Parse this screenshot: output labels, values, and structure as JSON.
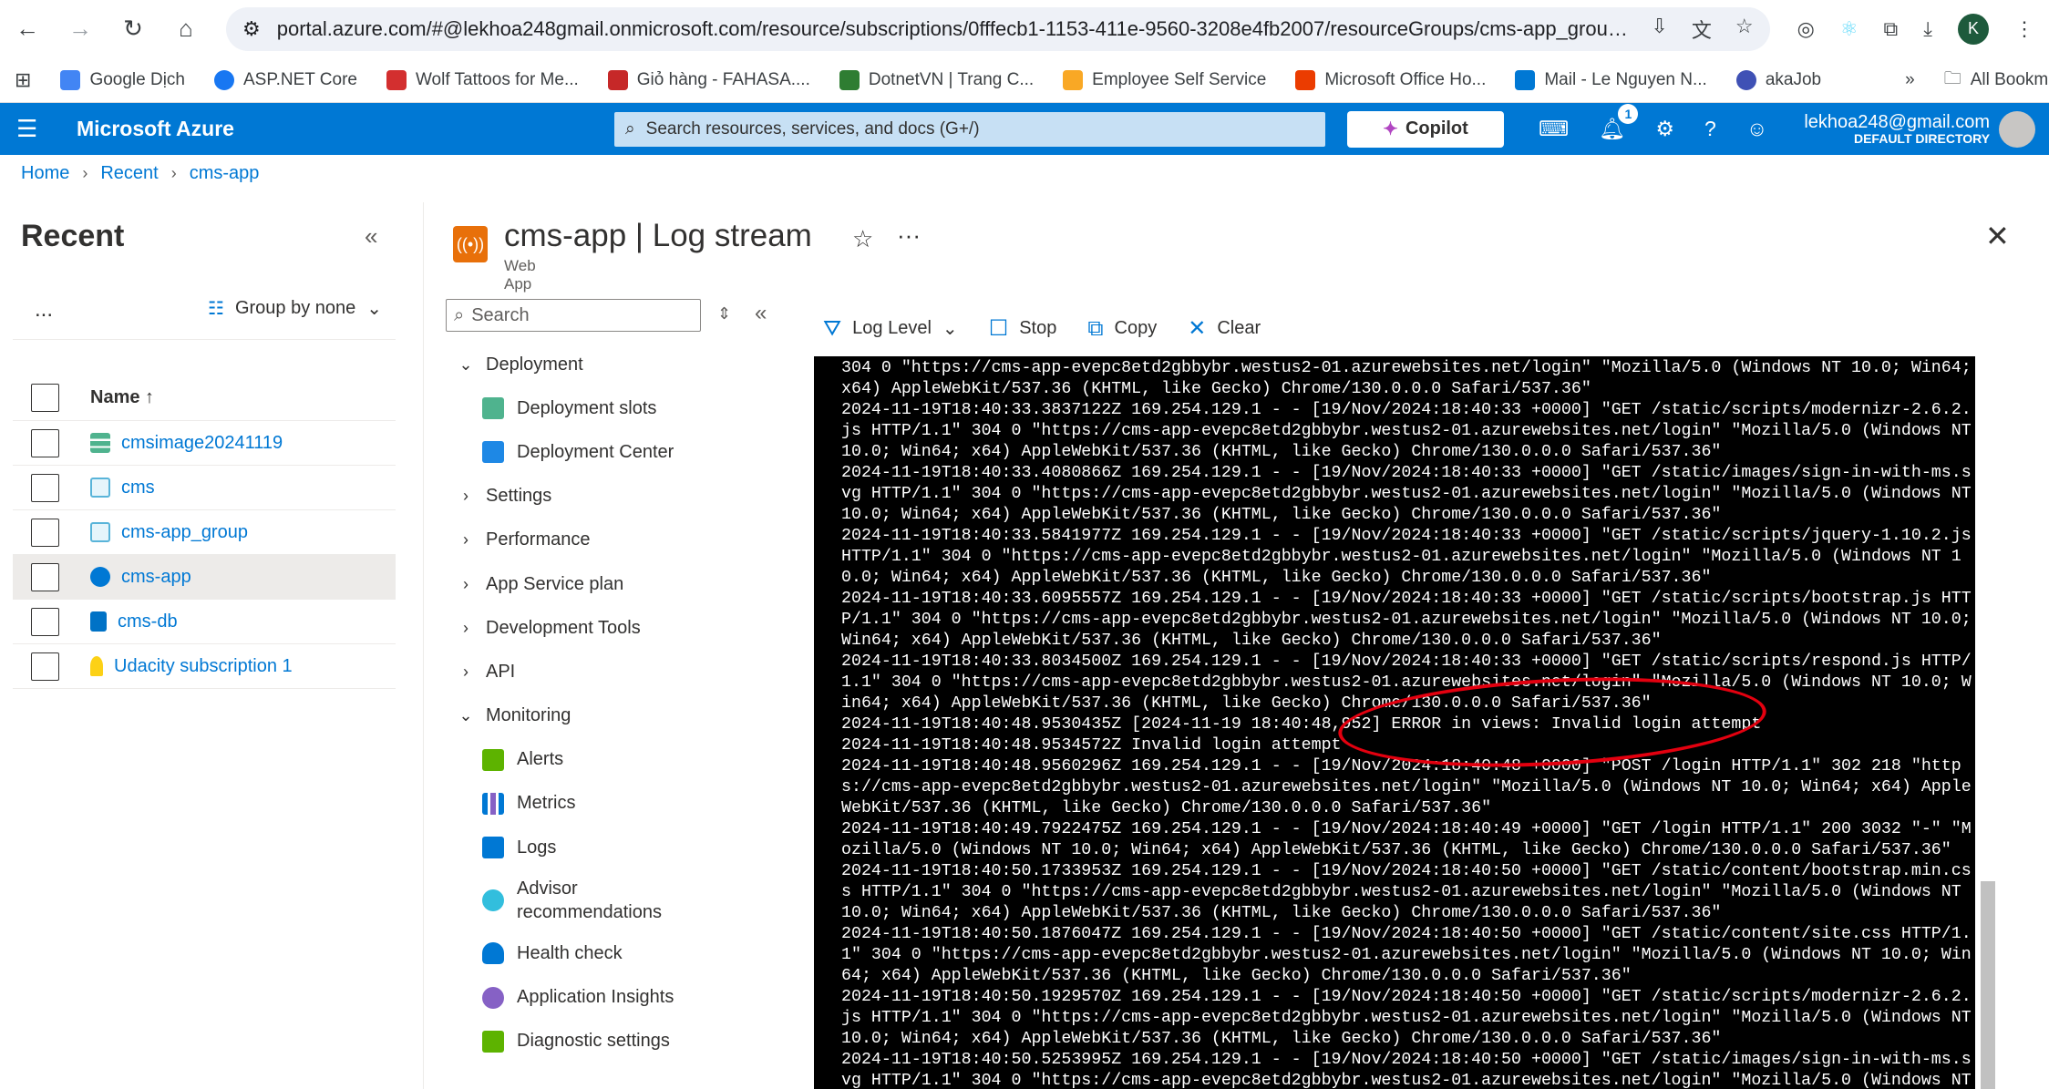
{
  "browser": {
    "url": "portal.azure.com/#@lekhoa248gmail.onmicrosoft.com/resource/subscriptions/0fffecb1-1153-411e-9560-3208e4fb2007/resourceGroups/cms-app_group...",
    "avatar_letter": "K",
    "bookmarks": [
      "Google Dịch",
      "ASP.NET Core",
      "Wolf Tattoos for Me...",
      "Giỏ hàng - FAHASA....",
      "DotnetVN | Trang C...",
      "Employee Self Service",
      "Microsoft Office Ho...",
      "Mail - Le Nguyen N...",
      "akaJob"
    ],
    "all_bookmarks": "All Bookmarks",
    "more": "»"
  },
  "azure": {
    "brand": "Microsoft Azure",
    "search_placeholder": "Search resources, services, and docs (G+/)",
    "copilot": "Copilot",
    "notif_count": "1",
    "account_email": "lekhoa248@gmail.com",
    "account_dir": "DEFAULT DIRECTORY"
  },
  "breadcrumb": [
    "Home",
    "Recent",
    "cms-app"
  ],
  "recent": {
    "title": "Recent",
    "more": "...",
    "group_by": "Group by none",
    "header": "Name ↑",
    "items": [
      "cmsimage20241119",
      "cms",
      "cms-app_group",
      "cms-app",
      "cms-db",
      "Udacity subscription 1"
    ]
  },
  "blade": {
    "title": "cms-app | Log stream",
    "subtitle": "Web App"
  },
  "menu": {
    "search_placeholder": "Search",
    "items": [
      {
        "label": "Deployment",
        "type": "expanded"
      },
      {
        "label": "Deployment slots",
        "type": "child"
      },
      {
        "label": "Deployment Center",
        "type": "child"
      },
      {
        "label": "Settings",
        "type": "collapsed"
      },
      {
        "label": "Performance",
        "type": "collapsed"
      },
      {
        "label": "App Service plan",
        "type": "collapsed"
      },
      {
        "label": "Development Tools",
        "type": "collapsed"
      },
      {
        "label": "API",
        "type": "collapsed"
      },
      {
        "label": "Monitoring",
        "type": "expanded"
      },
      {
        "label": "Alerts",
        "type": "child"
      },
      {
        "label": "Metrics",
        "type": "child"
      },
      {
        "label": "Logs",
        "type": "child"
      },
      {
        "label": "Advisor recommendations",
        "type": "child"
      },
      {
        "label": "Health check",
        "type": "child"
      },
      {
        "label": "Application Insights",
        "type": "child"
      },
      {
        "label": "Diagnostic settings",
        "type": "child"
      }
    ]
  },
  "toolbar": {
    "log_level": "Log Level",
    "stop": "Stop",
    "copy": "Copy",
    "clear": "Clear"
  },
  "log": {
    "text": "304 0 \"https://cms-app-evepc8etd2gbbybr.westus2-01.azurewebsites.net/login\" \"Mozilla/5.0 (Windows NT 10.0; Win64; x64) AppleWebKit/537.36 (KHTML, like Gecko) Chrome/130.0.0.0 Safari/537.36\"\n2024-11-19T18:40:33.3837122Z 169.254.129.1 - - [19/Nov/2024:18:40:33 +0000] \"GET /static/scripts/modernizr-2.6.2.js HTTP/1.1\" 304 0 \"https://cms-app-evepc8etd2gbbybr.westus2-01.azurewebsites.net/login\" \"Mozilla/5.0 (Windows NT 10.0; Win64; x64) AppleWebKit/537.36 (KHTML, like Gecko) Chrome/130.0.0.0 Safari/537.36\"\n2024-11-19T18:40:33.4080866Z 169.254.129.1 - - [19/Nov/2024:18:40:33 +0000] \"GET /static/images/sign-in-with-ms.svg HTTP/1.1\" 304 0 \"https://cms-app-evepc8etd2gbbybr.westus2-01.azurewebsites.net/login\" \"Mozilla/5.0 (Windows NT 10.0; Win64; x64) AppleWebKit/537.36 (KHTML, like Gecko) Chrome/130.0.0.0 Safari/537.36\"\n2024-11-19T18:40:33.5841977Z 169.254.129.1 - - [19/Nov/2024:18:40:33 +0000] \"GET /static/scripts/jquery-1.10.2.js HTTP/1.1\" 304 0 \"https://cms-app-evepc8etd2gbbybr.westus2-01.azurewebsites.net/login\" \"Mozilla/5.0 (Windows NT 10.0; Win64; x64) AppleWebKit/537.36 (KHTML, like Gecko) Chrome/130.0.0.0 Safari/537.36\"\n2024-11-19T18:40:33.6095557Z 169.254.129.1 - - [19/Nov/2024:18:40:33 +0000] \"GET /static/scripts/bootstrap.js HTTP/1.1\" 304 0 \"https://cms-app-evepc8etd2gbbybr.westus2-01.azurewebsites.net/login\" \"Mozilla/5.0 (Windows NT 10.0; Win64; x64) AppleWebKit/537.36 (KHTML, like Gecko) Chrome/130.0.0.0 Safari/537.36\"\n2024-11-19T18:40:33.8034500Z 169.254.129.1 - - [19/Nov/2024:18:40:33 +0000] \"GET /static/scripts/respond.js HTTP/1.1\" 304 0 \"https://cms-app-evepc8etd2gbbybr.westus2-01.azurewebsites.net/login\" \"Mozilla/5.0 (Windows NT 10.0; Win64; x64) AppleWebKit/537.36 (KHTML, like Gecko) Chrome/130.0.0.0 Safari/537.36\"\n2024-11-19T18:40:48.9530435Z [2024-11-19 18:40:48,952] ERROR in views: Invalid login attempt\n2024-11-19T18:40:48.9534572Z Invalid login attempt\n2024-11-19T18:40:48.9560296Z 169.254.129.1 - - [19/Nov/2024:18:40:48 +0000] \"POST /login HTTP/1.1\" 302 218 \"https://cms-app-evepc8etd2gbbybr.westus2-01.azurewebsites.net/login\" \"Mozilla/5.0 (Windows NT 10.0; Win64; x64) AppleWebKit/537.36 (KHTML, like Gecko) Chrome/130.0.0.0 Safari/537.36\"\n2024-11-19T18:40:49.7922475Z 169.254.129.1 - - [19/Nov/2024:18:40:49 +0000] \"GET /login HTTP/1.1\" 200 3032 \"-\" \"Mozilla/5.0 (Windows NT 10.0; Win64; x64) AppleWebKit/537.36 (KHTML, like Gecko) Chrome/130.0.0.0 Safari/537.36\"\n2024-11-19T18:40:50.1733953Z 169.254.129.1 - - [19/Nov/2024:18:40:50 +0000] \"GET /static/content/bootstrap.min.css HTTP/1.1\" 304 0 \"https://cms-app-evepc8etd2gbbybr.westus2-01.azurewebsites.net/login\" \"Mozilla/5.0 (Windows NT 10.0; Win64; x64) AppleWebKit/537.36 (KHTML, like Gecko) Chrome/130.0.0.0 Safari/537.36\"\n2024-11-19T18:40:50.1876047Z 169.254.129.1 - - [19/Nov/2024:18:40:50 +0000] \"GET /static/content/site.css HTTP/1.1\" 304 0 \"https://cms-app-evepc8etd2gbbybr.westus2-01.azurewebsites.net/login\" \"Mozilla/5.0 (Windows NT 10.0; Win64; x64) AppleWebKit/537.36 (KHTML, like Gecko) Chrome/130.0.0.0 Safari/537.36\"\n2024-11-19T18:40:50.1929570Z 169.254.129.1 - - [19/Nov/2024:18:40:50 +0000] \"GET /static/scripts/modernizr-2.6.2.js HTTP/1.1\" 304 0 \"https://cms-app-evepc8etd2gbbybr.westus2-01.azurewebsites.net/login\" \"Mozilla/5.0 (Windows NT 10.0; Win64; x64) AppleWebKit/537.36 (KHTML, like Gecko) Chrome/130.0.0.0 Safari/537.36\"\n2024-11-19T18:40:50.5253995Z 169.254.129.1 - - [19/Nov/2024:18:40:50 +0000] \"GET /static/images/sign-in-with-ms.svg HTTP/1.1\" 304 0 \"https://cms-app-evepc8etd2gbbybr.westus2-01.azurewebsites.net/login\" \"Mozilla/5.0 (Windows NT"
  },
  "colors": {
    "azure_blue": "#0078d4",
    "annotation_red": "#e3000f",
    "console_bg": "#000000"
  }
}
